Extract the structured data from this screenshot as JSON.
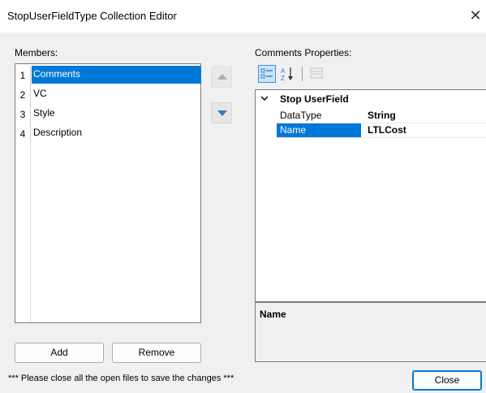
{
  "window": {
    "title": "StopUserFieldType Collection Editor",
    "close_glyph": "✕"
  },
  "members": {
    "label": "Members:",
    "items": [
      {
        "index": "1",
        "label": "Comments",
        "selected": true
      },
      {
        "index": "2",
        "label": "VC",
        "selected": false
      },
      {
        "index": "3",
        "label": "Style",
        "selected": false
      },
      {
        "index": "4",
        "label": "Description",
        "selected": false
      }
    ]
  },
  "buttons": {
    "add": "Add",
    "remove": "Remove",
    "close": "Close"
  },
  "properties": {
    "label": "Comments Properties:",
    "category": "Stop UserField",
    "rows": [
      {
        "name": "DataType",
        "value": "String",
        "selected": false
      },
      {
        "name": "Name",
        "value": "LTLCost",
        "selected": true
      }
    ],
    "description_title": "Name"
  },
  "footer": {
    "note": "*** Please close all the open files to save the changes ***"
  },
  "colors": {
    "selection": "#0078d7",
    "background": "#f0f0f0"
  }
}
